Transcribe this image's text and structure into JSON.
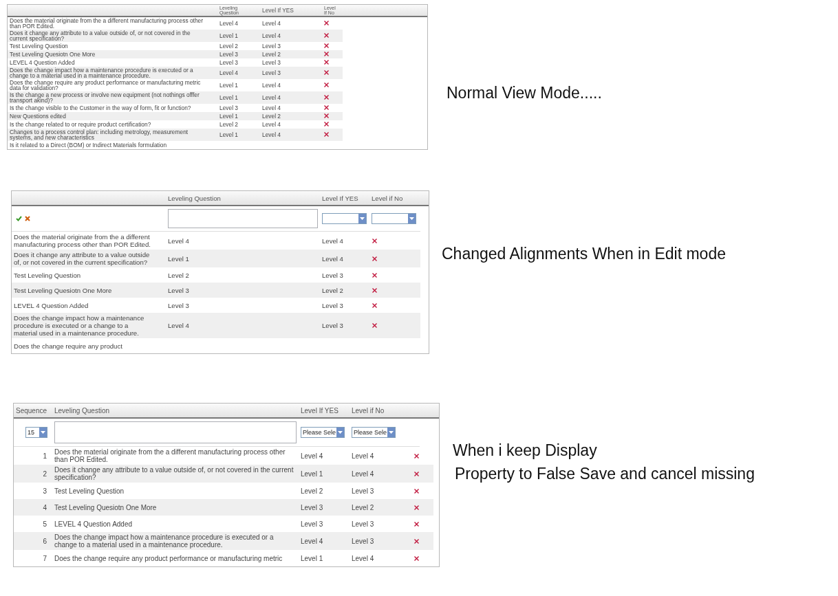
{
  "panels": [
    {
      "kind": "view",
      "caption": [
        "Normal View Mode....."
      ],
      "columns": [
        {
          "kind": "question"
        },
        {
          "label": "Leveling Question",
          "kind": "level_1"
        },
        {
          "label": "Level If YES",
          "kind": "level_2"
        },
        {
          "label": "Level If No",
          "kind": "delete"
        }
      ],
      "rows": [
        {
          "question": "Does the material originate from the a different manufacturing process other than POR Edited.",
          "level_1": "Level 4",
          "level_2": "Level 4"
        },
        {
          "question": "Does it change any attribute to a value outside of, or not covered in the current specification?",
          "level_1": "Level 1",
          "level_2": "Level 4"
        },
        {
          "question": "Test Leveling Question",
          "level_1": "Level 2",
          "level_2": "Level 3"
        },
        {
          "question": "Test Leveling Quesiotn One More",
          "level_1": "Level 3",
          "level_2": "Level 2"
        },
        {
          "question": "LEVEL 4 Question Added",
          "level_1": "Level 3",
          "level_2": "Level 3"
        },
        {
          "question": "Does the change impact how a maintenance procedure is executed or a change to a material used in a maintenance procedure.",
          "level_1": "Level 4",
          "level_2": "Level 3"
        },
        {
          "question": "Does the change require any product performance or manufacturing metric data for validation?",
          "level_1": "Level 1",
          "level_2": "Level 4"
        },
        {
          "question": "Is the change a new process or involve new equipment (not nothings offfer transport akind)?",
          "level_1": "Level 1",
          "level_2": "Level 4"
        },
        {
          "question": "Is the change visible to the Customer in the way of form, fit or function?",
          "level_1": "Level 3",
          "level_2": "Level 4"
        },
        {
          "question": "New Questions edited",
          "level_1": "Level 1",
          "level_2": "Level 2"
        },
        {
          "question": "Is the change related to or require product certification?",
          "level_1": "Level 2",
          "level_2": "Level 4"
        },
        {
          "question": "Changes to a process control plan: including metrology, measurement systems, and new characteristics",
          "level_1": "Level 1",
          "level_2": "Level 4"
        },
        {
          "question": "Is it related to a Direct (BOM) or Indirect Materials formulation"
        }
      ]
    },
    {
      "kind": "edit",
      "caption": [
        "Changed Alignments When in Edit mode"
      ],
      "columns": [
        {
          "kind": "question",
          "editor": {
            "kind": "actions"
          }
        },
        {
          "label": "Leveling Question",
          "kind": "level_1",
          "editor": {
            "kind": "textarea"
          }
        },
        {
          "label": "Level If YES",
          "kind": "level_2",
          "editor": {
            "kind": "select"
          }
        },
        {
          "label": "Level if No",
          "kind": "delete",
          "editor": {
            "kind": "select"
          }
        }
      ],
      "rows": [
        {
          "question": "Does the material originate from the a different manufacturing process other than POR Edited.",
          "level_1": "Level 4",
          "level_2": "Level 4"
        },
        {
          "question": "Does it change any attribute to a value outside of, or not covered in the current specification?",
          "level_1": "Level 1",
          "level_2": "Level 4"
        },
        {
          "question": "Test Leveling Question",
          "level_1": "Level 2",
          "level_2": "Level 3"
        },
        {
          "question": "Test Leveling Quesiotn One More",
          "level_1": "Level 3",
          "level_2": "Level 2"
        },
        {
          "question": "LEVEL 4 Question Added",
          "level_1": "Level 3",
          "level_2": "Level 3"
        },
        {
          "question": "Does the change impact how a maintenance procedure is executed or a change to a material used in a maintenance procedure.",
          "level_1": "Level 4",
          "level_2": "Level 3"
        },
        {
          "question": "Does the change require any product"
        }
      ]
    },
    {
      "kind": "sequence",
      "caption": [
        "When i keep Display",
        "Property to False Save and cancel missing"
      ],
      "columns": [
        {
          "label": "Sequence",
          "kind": "sequence",
          "editor": {
            "kind": "select",
            "value": "15"
          }
        },
        {
          "label": "Leveling Question",
          "kind": "question",
          "editor": {
            "kind": "textarea"
          }
        },
        {
          "label": "Level If YES",
          "kind": "level_1",
          "editor": {
            "kind": "select",
            "value": "Please Sele"
          }
        },
        {
          "label": "Level if No",
          "kind": "level_2",
          "editor": {
            "kind": "select",
            "value": "Please Sele"
          }
        },
        {
          "kind": "delete"
        }
      ],
      "rows": [
        {
          "sequence": "1",
          "question": "Does the material originate from the a different manufacturing process other than POR Edited.",
          "level_1": "Level 4",
          "level_2": "Level 4"
        },
        {
          "sequence": "2",
          "question": "Does it change any attribute to a value outside of, or not covered in the current specification?",
          "level_1": "Level 1",
          "level_2": "Level 4"
        },
        {
          "sequence": "3",
          "question": "Test Leveling Question",
          "level_1": "Level 2",
          "level_2": "Level 3"
        },
        {
          "sequence": "4",
          "question": "Test Leveling Quesiotn One More",
          "level_1": "Level 3",
          "level_2": "Level 2"
        },
        {
          "sequence": "5",
          "question": "LEVEL 4 Question Added",
          "level_1": "Level 3",
          "level_2": "Level 3"
        },
        {
          "sequence": "6",
          "question": "Does the change impact how a maintenance procedure is executed or a change to a material used in a maintenance procedure.",
          "level_1": "Level 4",
          "level_2": "Level 3"
        },
        {
          "sequence": "7",
          "question": "Does the change require any product performance or manufacturing metric",
          "level_1": "Level 1",
          "level_2": "Level 4"
        }
      ]
    }
  ]
}
